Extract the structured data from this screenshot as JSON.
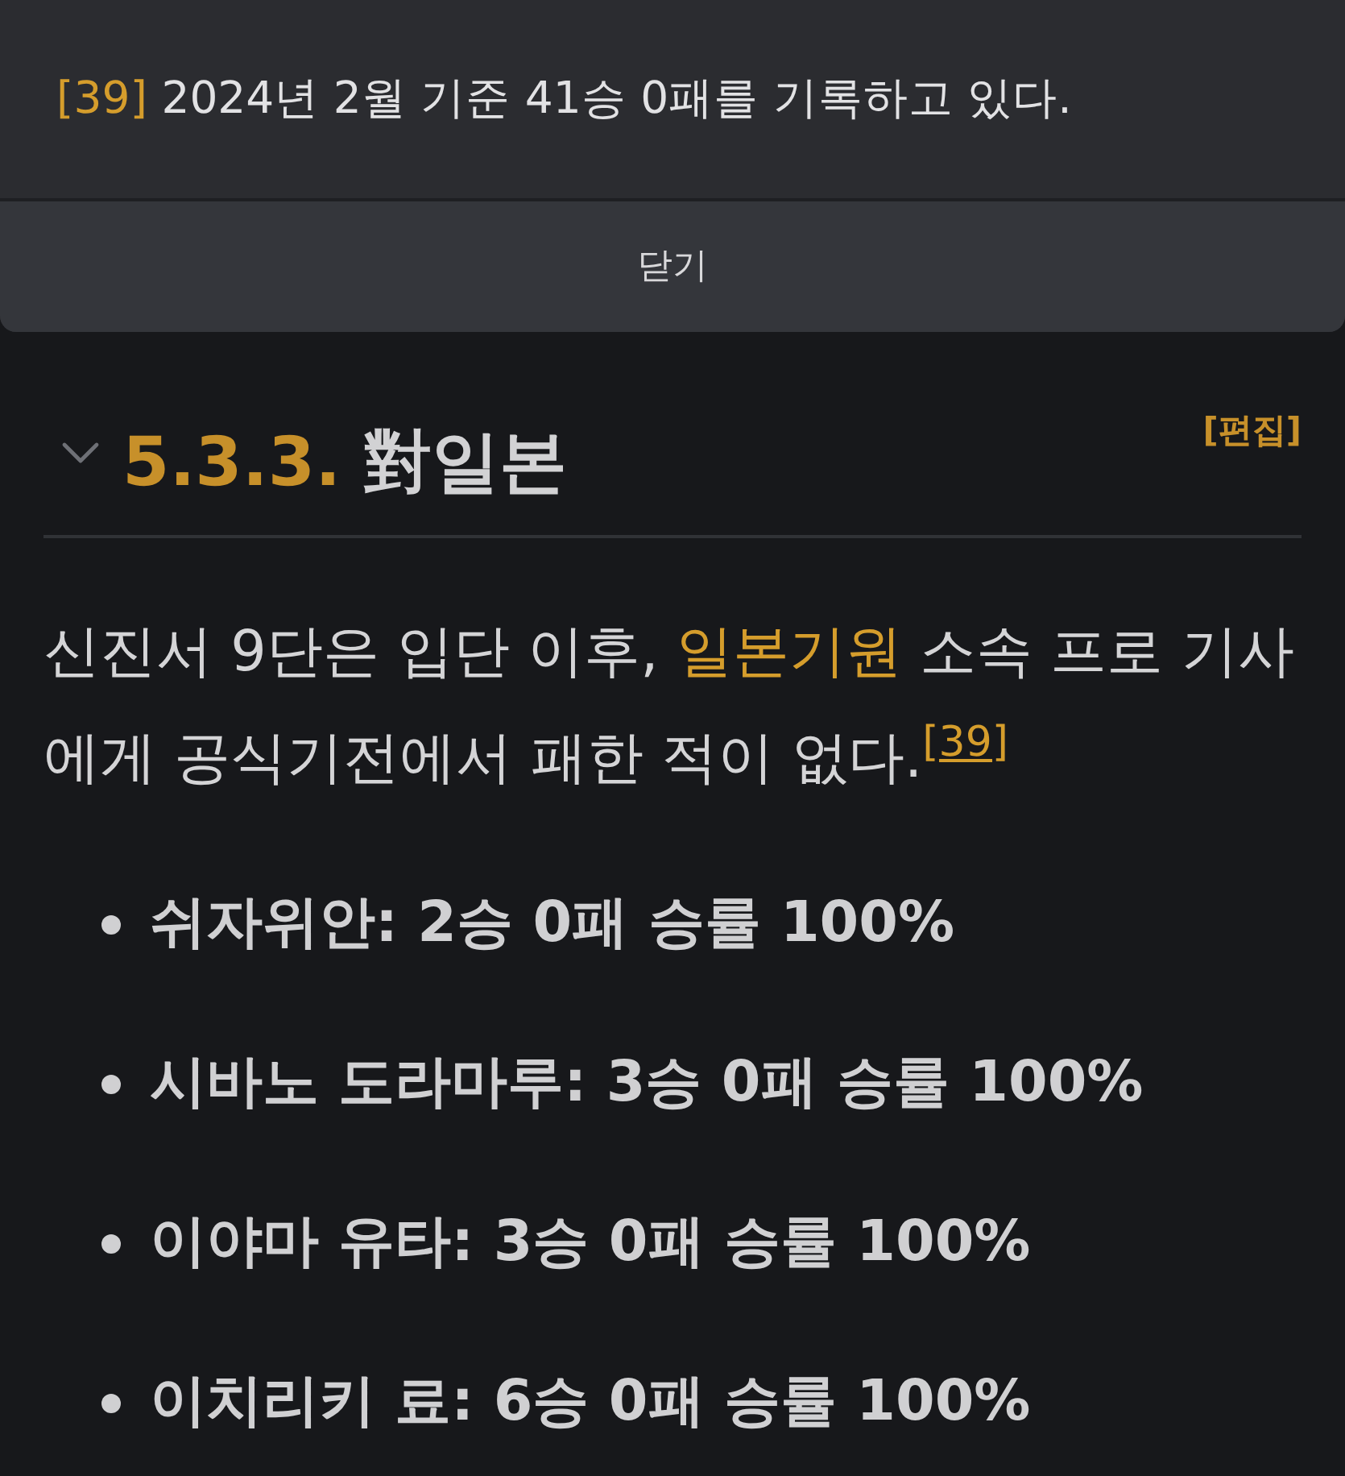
{
  "footnote_popup": {
    "ref": "[39]",
    "text": "2024년 2월 기준 41승 0패를 기록하고 있다.",
    "close_button": "닫기"
  },
  "section": {
    "expanded": true,
    "number": "5.3.3.",
    "title": "對일본",
    "edit_link": "[편집]"
  },
  "paragraph": {
    "text_before": "신진서 9단은 입단 이후, ",
    "link": "일본기원",
    "text_after": " 소속 프로 기사에게 공식기전에서 패한 적이 없다.",
    "footnote": "[39]"
  },
  "list": [
    "쉬자위안: 2승 0패 승률 100%",
    "시바노 도라마루: 3승 0패 승률 100%",
    "이야마 유타: 3승 0패 승률 100%",
    "이치리키 료: 6승 0패 승률 100%"
  ]
}
